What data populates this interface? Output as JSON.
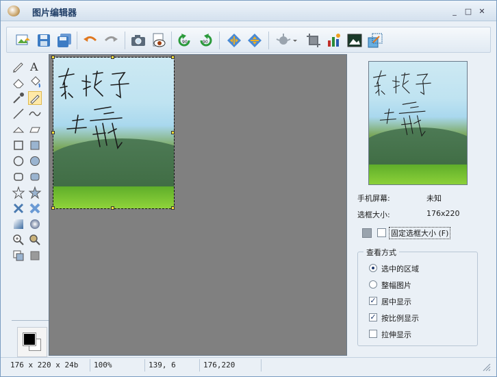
{
  "window": {
    "title": "图片编辑器"
  },
  "preview_info": {
    "screen_label": "手机屏幕:",
    "screen_value": "未知",
    "box_label": "选框大小:",
    "box_value": "176x220",
    "fixed_size_label": "固定选框大小 (F)"
  },
  "view_mode": {
    "title": "查看方式",
    "options": [
      {
        "label": "选中的区域",
        "type": "radio",
        "checked": true
      },
      {
        "label": "整幅图片",
        "type": "radio",
        "checked": false
      },
      {
        "label": "居中显示",
        "type": "checkbox",
        "checked": true
      },
      {
        "label": "按比例显示",
        "type": "checkbox",
        "checked": true
      },
      {
        "label": "拉伸显示",
        "type": "checkbox",
        "checked": false
      }
    ]
  },
  "status": {
    "dimensions": "176 x 220 x 24b",
    "zoom": "100%",
    "cursor": "139, 6",
    "selection": "176,220"
  },
  "colors": {
    "foreground": "#000000",
    "background": "#ffffff"
  }
}
